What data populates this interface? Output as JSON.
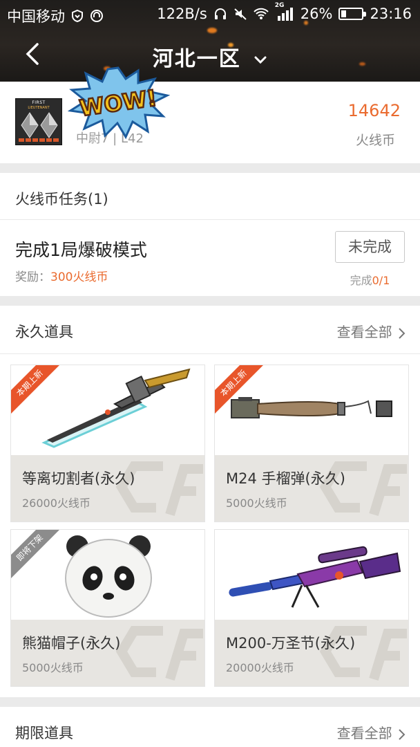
{
  "status_bar": {
    "carrier": "中国移动",
    "speed": "122B/s",
    "network": "2G",
    "battery": "26%",
    "battery_level": 0.26,
    "time": "23:16"
  },
  "header": {
    "title": "河北一区"
  },
  "user": {
    "rank_text": "中尉7 | L42",
    "coins_value": "14642",
    "coins_label": "火线币",
    "sticker": "WOW!"
  },
  "task_section": {
    "title": "火线币任务(1)",
    "task": {
      "name": "完成1局爆破模式",
      "reward_label": "奖励：",
      "reward_value": "300火线币",
      "button": "未完成",
      "progress_label": "完成",
      "progress_value": "0/1"
    }
  },
  "permanent": {
    "title": "永久道具",
    "see_all": "查看全部",
    "items": [
      {
        "name": "等离切割者(永久)",
        "price": "26000火线币",
        "tag": "本期上新"
      },
      {
        "name": "M24 手榴弹(永久)",
        "price": "5000火线币",
        "tag": "本期上新"
      },
      {
        "name": "熊猫帽子(永久)",
        "price": "5000火线币",
        "tag": "即将下架"
      },
      {
        "name": "M200-万圣节(永久)",
        "price": "20000火线币",
        "tag": ""
      }
    ]
  },
  "limited": {
    "title": "期限道具",
    "see_all": "查看全部"
  },
  "colors": {
    "accent": "#ea6b2f",
    "ribbon_new": "#e8552a",
    "ribbon_off": "#8c8c8c",
    "header_bg": "#241f1c"
  }
}
